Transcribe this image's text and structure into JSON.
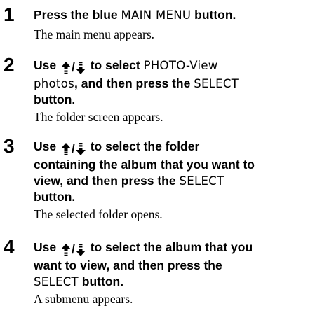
{
  "steps": [
    {
      "number": "1",
      "lines": [
        [
          {
            "t": "Press the blue "
          },
          {
            "t": "MAIN MENU",
            "ui": true
          },
          {
            "t": " button."
          }
        ]
      ],
      "result": "The main menu appears."
    },
    {
      "number": "2",
      "lines": [
        [
          {
            "t": "Use "
          },
          {
            "arrows": true
          },
          {
            "t": " to select "
          },
          {
            "t": "PHOTO-View",
            "ui": true
          }
        ],
        [
          {
            "t": "photos",
            "ui": true
          },
          {
            "t": ", and then press the "
          },
          {
            "t": "SELECT",
            "ui": true
          }
        ],
        [
          {
            "t": "button."
          }
        ]
      ],
      "result": "The folder screen appears."
    },
    {
      "number": "3",
      "lines": [
        [
          {
            "t": "Use "
          },
          {
            "arrows": true
          },
          {
            "t": " to select the folder"
          }
        ],
        [
          {
            "t": "containing the album that you want to"
          }
        ],
        [
          {
            "t": "view, and then press the "
          },
          {
            "t": "SELECT",
            "ui": true
          }
        ],
        [
          {
            "t": "button."
          }
        ]
      ],
      "result": "The selected folder opens."
    },
    {
      "number": "4",
      "lines": [
        [
          {
            "t": "Use "
          },
          {
            "arrows": true
          },
          {
            "t": " to select the album that you"
          }
        ],
        [
          {
            "t": "want to view, and then press the"
          }
        ],
        [
          {
            "t": "SELECT",
            "ui": true
          },
          {
            "t": " button."
          }
        ]
      ],
      "result": "A submenu appears."
    }
  ],
  "icons": {
    "up": "up-arrow-icon",
    "down": "down-arrow-icon",
    "separator": "/"
  }
}
